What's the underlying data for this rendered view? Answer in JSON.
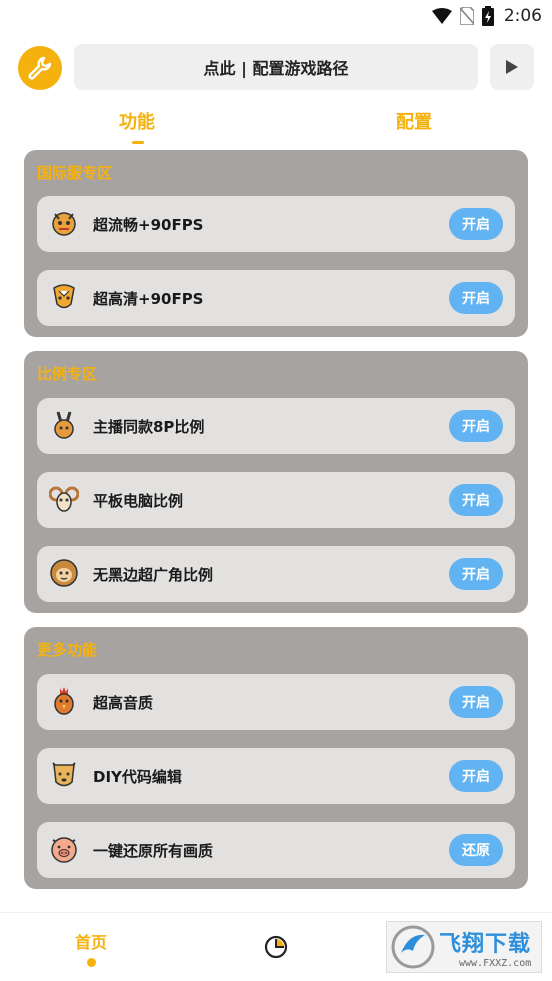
{
  "statusbar": {
    "time": "2:06"
  },
  "header": {
    "path_button": "点此 | 配置游戏路径"
  },
  "tabs": [
    {
      "label": "功能",
      "active": true
    },
    {
      "label": "配置",
      "active": false
    }
  ],
  "sections": [
    {
      "title": "国际服专区",
      "items": [
        {
          "icon": "dragon-icon",
          "label": "超流畅+90FPS",
          "button": "开启"
        },
        {
          "icon": "snake-icon",
          "label": "超高清+90FPS",
          "button": "开启"
        }
      ]
    },
    {
      "title": "比例专区",
      "items": [
        {
          "icon": "rabbit-icon",
          "label": "主播同款8P比例",
          "button": "开启"
        },
        {
          "icon": "goat-icon",
          "label": "平板电脑比例",
          "button": "开启"
        },
        {
          "icon": "monkey-icon",
          "label": "无黑边超广角比例",
          "button": "开启"
        }
      ]
    },
    {
      "title": "更多功能",
      "items": [
        {
          "icon": "rooster-icon",
          "label": "超高音质",
          "button": "开启"
        },
        {
          "icon": "dog-icon",
          "label": "DIY代码编辑",
          "button": "开启"
        },
        {
          "icon": "pig-icon",
          "label": "一键还原所有画质",
          "button": "还原"
        }
      ]
    }
  ],
  "bottom_nav": {
    "home_label": "首页"
  },
  "watermark": {
    "brand": "飞翔下载",
    "url": "www.FXXZ.com"
  },
  "colors": {
    "accent": "#f5b20f",
    "button": "#61b4f1",
    "section_bg": "#a7a3a1",
    "row_bg": "#e2e1e0"
  }
}
